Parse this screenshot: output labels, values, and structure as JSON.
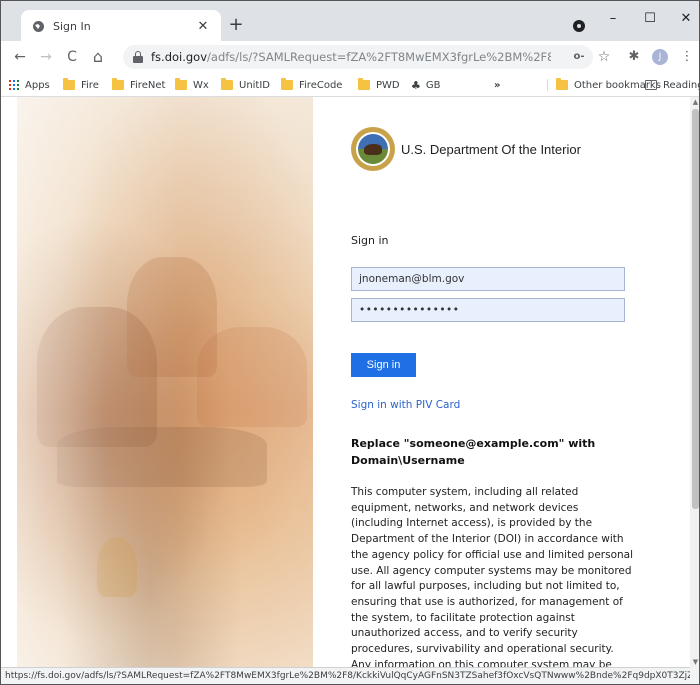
{
  "browser": {
    "tab": {
      "title": "Sign In"
    },
    "window_controls": {
      "minimize": "–",
      "maximize": "☐",
      "close": "✕"
    },
    "new_tab": "+",
    "toolbar": {
      "back": "←",
      "forward": "→",
      "reload": "C",
      "home": "⌂",
      "url_host": "fs.doi.gov",
      "url_path": "/adfs/ls/?SAMLRequest=fZA%2FT8MwEMX3fgrLe%2BM%2F8JKckkiVulQ...",
      "key_icon": "o-",
      "star_icon": "☆",
      "extensions_icon": "✱",
      "avatar_letter": "J",
      "menu_icon": "⋮"
    },
    "bookmarks": {
      "apps": "Apps",
      "items": [
        "Fire",
        "FireNet",
        "Wx",
        "UnitID",
        "FireCode",
        "PWD",
        "GB"
      ],
      "overflow": "»",
      "other": "Other bookmarks",
      "reading_list": "Reading list"
    }
  },
  "page": {
    "department": "U.S. Department Of the Interior",
    "signin_heading": "Sign in",
    "username_value": "jnoneman@blm.gov",
    "password_value": "•••••••••••••••",
    "signin_button": "Sign in",
    "piv_link": "Sign in with PIV Card",
    "notice_title": "Replace \"someone@example.com\" with Domain\\Username",
    "notice_body": "This computer system, including all related equipment, networks, and network devices (including Internet access), is provided by the Department of the Interior (DOI) in accordance with the agency policy for official use and limited personal use. All agency computer systems may be monitored for all lawful purposes, including but not limited to, ensuring that use is authorized, for management of the system, to facilitate protection against unauthorized access, and to verify security procedures, survivability and operational security. Any information on this computer system may be examined, recorded, copied and used for"
  },
  "status_bar": {
    "url": "https://fs.doi.gov/adfs/ls/?SAMLRequest=fZA%2FT8MwEMX3fgrLe%2BM%2F8/KckkiVulQqCyAGFnSN3TZSahef3fOxcVsQTNwww%2Bnde%2Fq9dpX0T3ZjZQ..."
  },
  "colors": {
    "accent": "#1f6fe5",
    "link": "#2a62c9",
    "input_fill": "#e8f0fe",
    "tabstrip": "#dee1e6"
  }
}
